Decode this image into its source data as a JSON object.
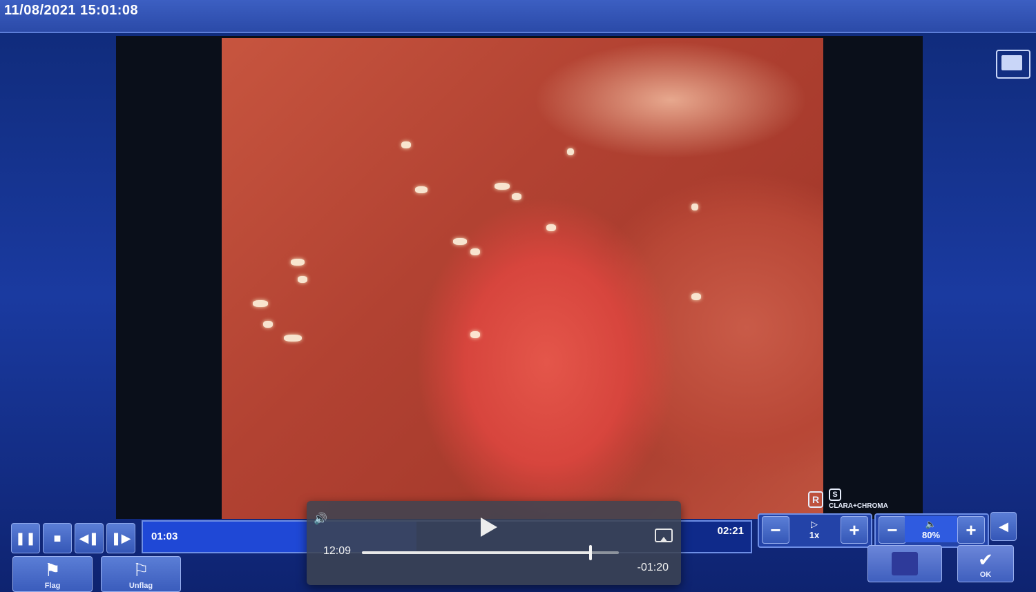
{
  "window": {
    "timestamp": "11/08/2021 15:01:08"
  },
  "player": {
    "elapsed": "01:03",
    "total": "02:21",
    "progress_fraction": 0.45,
    "speed_label": "1x",
    "volume_label": "80%"
  },
  "logos": {
    "r_mark": "R",
    "s_mark": "S",
    "mode_label": "CLARA+CHROMA"
  },
  "buttons": {
    "flag_label": "Flag",
    "unflag_label": "Unflag",
    "ok_label": "OK",
    "minus_glyph": "−",
    "plus_glyph": "+"
  },
  "overlay": {
    "current_time": "12:09",
    "remaining_time": "-01:20",
    "scrub_fraction": 0.89
  },
  "icons": {
    "pause": "pause-icon",
    "stop": "stop-icon",
    "step_back": "step-back-icon",
    "step_forward": "step-forward-icon",
    "flag": "flag-icon",
    "unflag": "unflag-icon",
    "ok": "checkmark-icon",
    "fullscreen": "fullscreen-icon",
    "speaker": "speaker-icon",
    "airplay": "airplay-icon"
  }
}
